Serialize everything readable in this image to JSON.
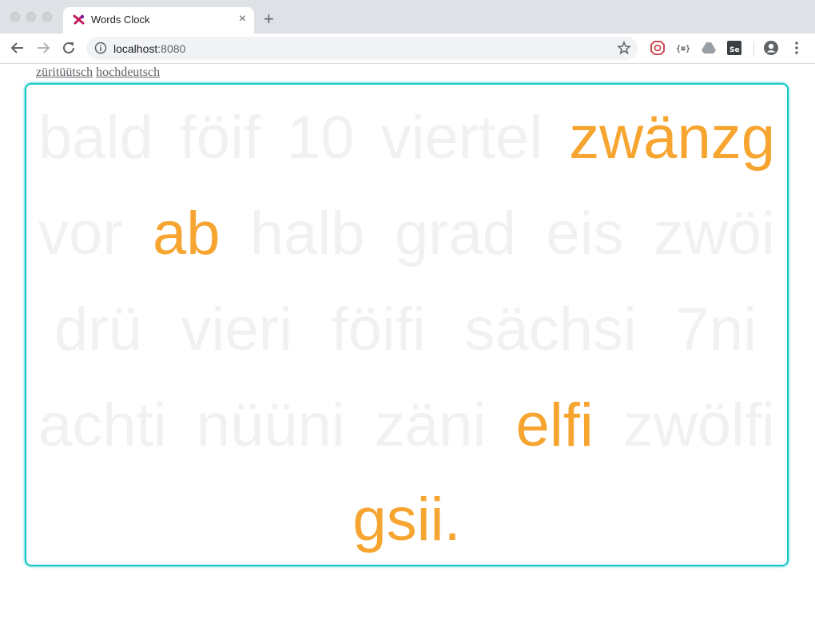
{
  "browser": {
    "tab_title": "Words Clock",
    "url_host": "localhost",
    "url_port": ":8080",
    "new_tab_label": "+",
    "close_label": "×"
  },
  "lang_links": [
    "züritüütsch",
    "hochdeutsch"
  ],
  "colors": {
    "active": "#f7a531",
    "inactive": "#f1f1f1",
    "frame": "#12c7c7"
  },
  "clock": {
    "rows": [
      {
        "words": [
          {
            "text": "bald",
            "active": false
          },
          {
            "text": "föif",
            "active": false
          },
          {
            "text": "10",
            "active": false
          },
          {
            "text": "viertel",
            "active": false
          },
          {
            "text": "zwänzg",
            "active": true
          }
        ]
      },
      {
        "words": [
          {
            "text": "vor",
            "active": false
          },
          {
            "text": "ab",
            "active": true
          },
          {
            "text": "halb",
            "active": false
          },
          {
            "text": "grad",
            "active": false
          },
          {
            "text": "eis",
            "active": false
          },
          {
            "text": "zwöi",
            "active": false
          }
        ]
      },
      {
        "words": [
          {
            "text": "drü",
            "active": false
          },
          {
            "text": "vieri",
            "active": false
          },
          {
            "text": "föifi",
            "active": false
          },
          {
            "text": "sächsi",
            "active": false
          },
          {
            "text": "7ni",
            "active": false
          }
        ]
      },
      {
        "words": [
          {
            "text": "achti",
            "active": false
          },
          {
            "text": "nüüni",
            "active": false
          },
          {
            "text": "zäni",
            "active": false
          },
          {
            "text": "elfi",
            "active": true
          },
          {
            "text": "zwölfi",
            "active": false
          }
        ]
      },
      {
        "words": [
          {
            "text": "gsii.",
            "active": true
          }
        ]
      }
    ]
  }
}
